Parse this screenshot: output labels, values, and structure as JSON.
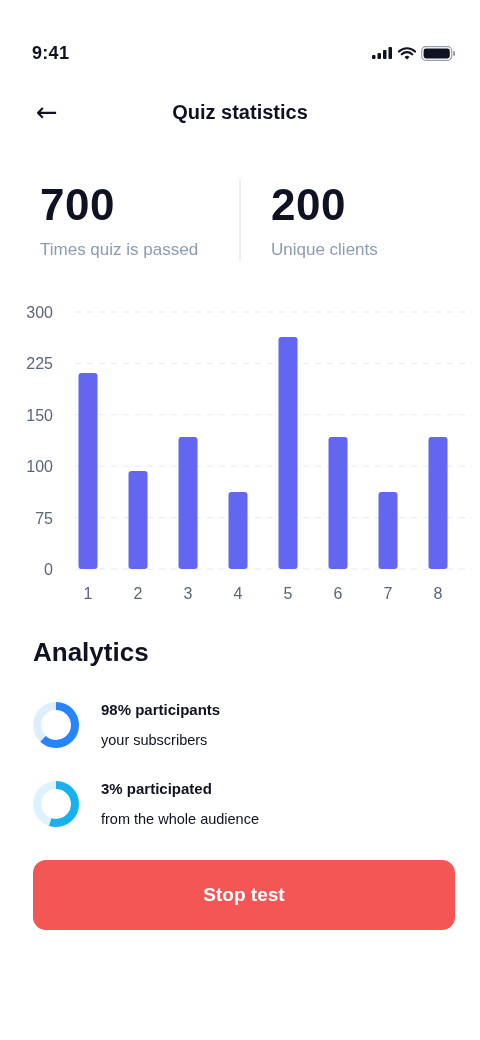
{
  "status_bar": {
    "time": "9:41"
  },
  "header": {
    "back": "←",
    "title": "Quiz statistics"
  },
  "stats": [
    {
      "value": "700",
      "label": "Times quiz is passed"
    },
    {
      "value": "200",
      "label": "Unique clients"
    }
  ],
  "chart": {
    "y_axis_labels": [
      "300",
      "225",
      "150",
      "100",
      "75",
      "0"
    ],
    "x_axis_labels": [
      "1",
      "2",
      "3",
      "4",
      "5",
      "6",
      "7",
      "8"
    ]
  },
  "analytics": {
    "title": "Analytics",
    "items": [
      {
        "title": "98% participants",
        "subtitle": "your subscribers",
        "level": 0.62,
        "color": "#2684ff"
      },
      {
        "title": "3% participated",
        "subtitle": "from the whole audience",
        "level": 0.55,
        "color": "#16b2ee"
      }
    ]
  },
  "button": {
    "label": "Stop test"
  }
}
